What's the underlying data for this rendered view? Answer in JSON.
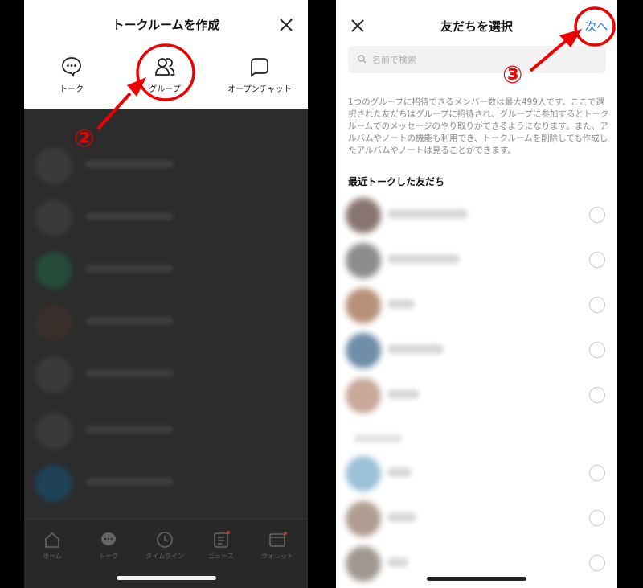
{
  "left_screen": {
    "title": "トークルームを作成",
    "options": [
      {
        "label": "トーク",
        "icon": "chat-bubble-icon"
      },
      {
        "label": "グループ",
        "icon": "group-icon"
      },
      {
        "label": "オープンチャット",
        "icon": "open-chat-icon"
      }
    ],
    "bottom_nav": [
      {
        "label": "ホーム",
        "icon": "home-icon"
      },
      {
        "label": "トーク",
        "icon": "chat-icon"
      },
      {
        "label": "タイムライン",
        "icon": "clock-icon"
      },
      {
        "label": "ニュース",
        "icon": "news-icon"
      },
      {
        "label": "ウォレット",
        "icon": "wallet-icon"
      }
    ]
  },
  "right_screen": {
    "title": "友だちを選択",
    "next_label": "次へ",
    "search_placeholder": "名前で検索",
    "notice": "1つのグループに招待できるメンバー数は最大499人です。ここで選択された友だちはグループに招待され、グループに参加するとトークルームでのメッセージのやり取りができるようになります。また、アルバムやノートの機能も利用でき、トークルームを削除しても作成したアルバムやノートは見ることができます。",
    "section_recent": "最近トークした友だち"
  },
  "annotations": {
    "step2": "②",
    "step3": "③",
    "color": "#ee0000"
  }
}
